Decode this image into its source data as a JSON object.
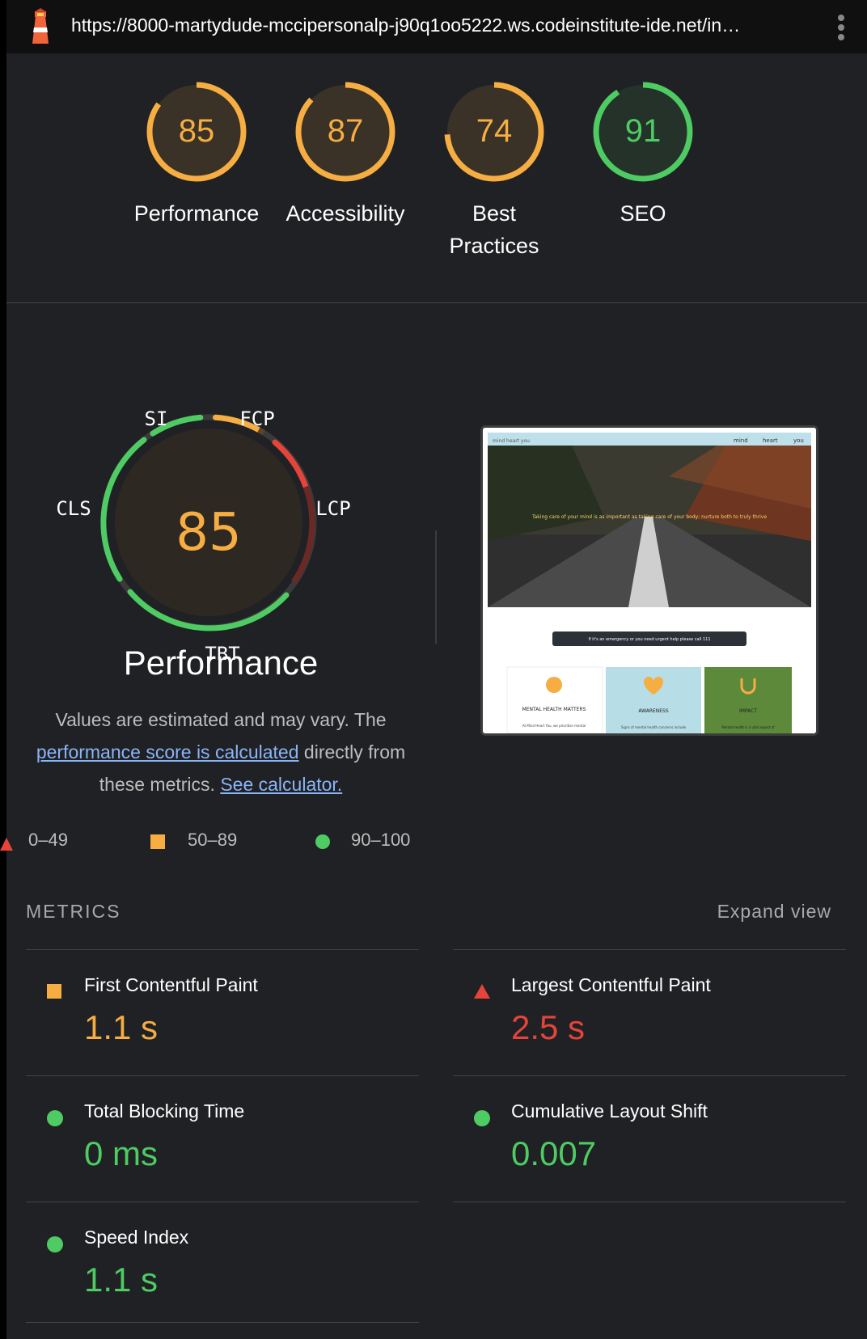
{
  "url": "https://8000-martydude-mccipersonalp-j90q1oo5222.ws.codeinstitute-ide.net/in…",
  "colors": {
    "orange": "#f6ad42",
    "red": "#e5443a",
    "green": "#4ecb62"
  },
  "scores": [
    {
      "label": "Performance",
      "score": "85",
      "value": 85,
      "rating": "orange"
    },
    {
      "label": "Accessibility",
      "score": "87",
      "value": 87,
      "rating": "orange"
    },
    {
      "label": "Best Practices",
      "score": "74",
      "value": 74,
      "rating": "orange"
    },
    {
      "label": "SEO",
      "score": "91",
      "value": 91,
      "rating": "green"
    }
  ],
  "perf": {
    "score": "85",
    "title": "Performance",
    "labels": {
      "si": "SI",
      "fcp": "FCP",
      "lcp": "LCP",
      "tbt": "TBT",
      "cls": "CLS"
    },
    "desc_1": "Values are estimated and may vary. The",
    "desc_link": "performance score is calculated",
    "desc_2": "directly from these metrics.",
    "calc_link": "See calculator."
  },
  "legend": {
    "low": "0–49",
    "mid": "50–89",
    "high": "90–100"
  },
  "preview": {
    "logo": "mind heart you",
    "nav": [
      "mind",
      "heart",
      "you"
    ],
    "hero_text": "Taking care of your mind is as important as taking care of your body; nurture both to truly thrive",
    "banner": "If it's an emergency or you need urgent help please call 111",
    "cards": [
      {
        "title": "MENTAL HEALTH MATTERS",
        "text": "At Mind Heart You, we prioritise mental"
      },
      {
        "title": "AWARENESS",
        "text": "Signs of mental health concerns include"
      },
      {
        "title": "IMPACT",
        "text": "Mental health is a vital aspect of"
      }
    ]
  },
  "metrics_header": "METRICS",
  "expand_label": "Expand view",
  "metrics": [
    {
      "name": "First Contentful Paint",
      "value": "1.1 s",
      "rating": "orange"
    },
    {
      "name": "Largest Contentful Paint",
      "value": "2.5 s",
      "rating": "red"
    },
    {
      "name": "Total Blocking Time",
      "value": "0 ms",
      "rating": "green"
    },
    {
      "name": "Cumulative Layout Shift",
      "value": "0.007",
      "rating": "green"
    },
    {
      "name": "Speed Index",
      "value": "1.1 s",
      "rating": "green"
    }
  ]
}
